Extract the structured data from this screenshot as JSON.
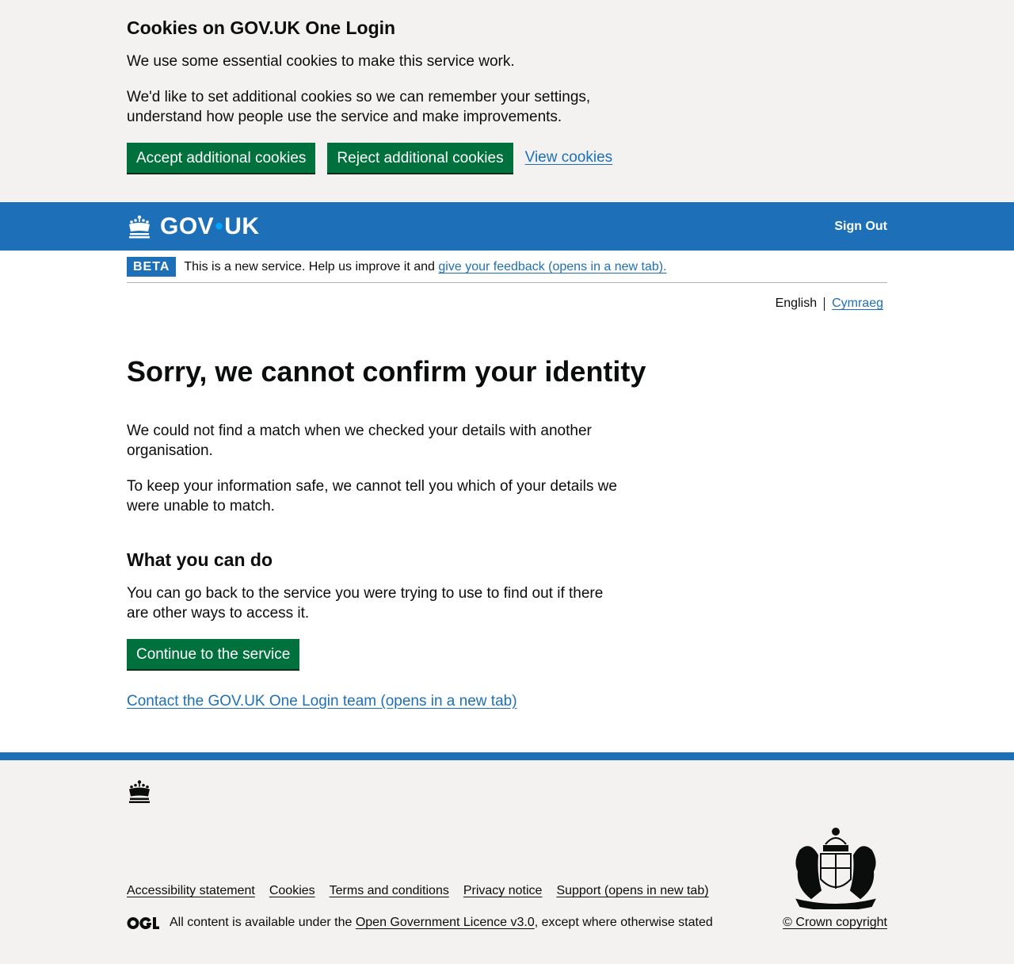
{
  "cookie_banner": {
    "title": "Cookies on GOV.UK One Login",
    "p1": "We use some essential cookies to make this service work.",
    "p2": "We'd like to set additional cookies so we can remember your settings, understand how people use the service and make improvements.",
    "accept_label": "Accept additional cookies",
    "reject_label": "Reject additional cookies",
    "view_label": "View cookies"
  },
  "header": {
    "logo_gov": "GOV",
    "logo_dot": "•",
    "logo_uk": "UK",
    "signout_label": "Sign Out"
  },
  "phase_banner": {
    "tag": "BETA",
    "text": "This is a new service. Help us improve it and ",
    "feedback_link": "give your feedback (opens in a new tab)."
  },
  "language": {
    "current": "English",
    "other": "Cymraeg"
  },
  "main": {
    "title": "Sorry, we cannot confirm your identity",
    "p1": "We could not find a match when we checked your details with another organisation.",
    "p2": "To keep your information safe, we cannot tell you which of your details we were unable to match.",
    "subheading": "What you can do",
    "p3": "You can go back to the service you were trying to use to find out if there are other ways to access it.",
    "continue_label": "Continue to the service",
    "contact_link": "Contact the GOV.UK One Login team (opens in a new tab)"
  },
  "footer": {
    "links": [
      "Accessibility statement",
      "Cookies",
      "Terms and conditions",
      "Privacy notice",
      "Support (opens in new tab)"
    ],
    "licence_prefix": "All content is available under the ",
    "licence_link": "Open Government Licence v3.0",
    "licence_suffix": ", except where otherwise stated",
    "copyright": "© Crown copyright"
  },
  "colors": {
    "brand_blue": "#1d70b8",
    "button_green": "#00703c",
    "link_blue": "#1d70b8",
    "banner_grey": "#f3f2f1"
  },
  "icons": {
    "header_logo": "crown-icon",
    "footer_logo": "crown-icon",
    "licence_logo": "ogl-logo-icon",
    "crest": "royal-coat-of-arms-icon"
  }
}
